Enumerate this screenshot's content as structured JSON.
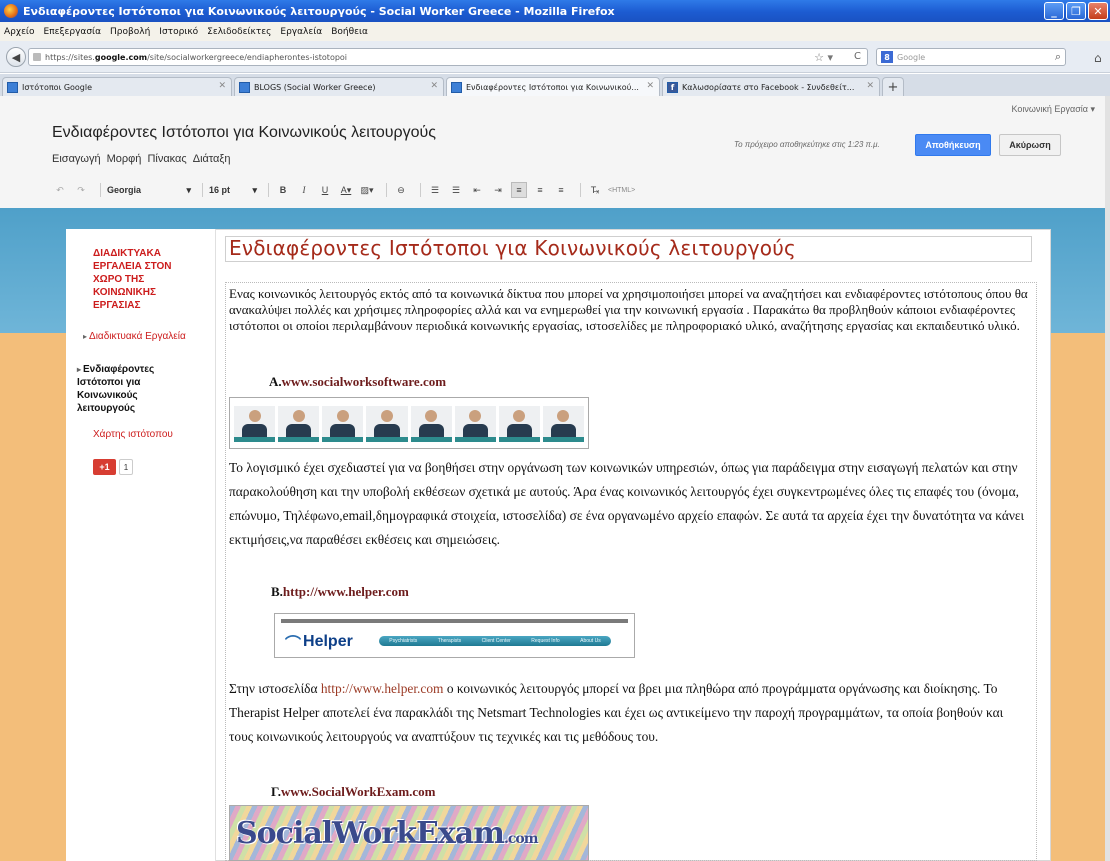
{
  "window": {
    "title": "Ενδιαφέροντες Ιστότοποι για Κοινωνικούς λειτουργούς - Social Worker Greece - Mozilla Firefox",
    "controls": [
      "_",
      "❐",
      "✕"
    ]
  },
  "menubar": [
    "Αρχείο",
    "Επεξεργασία",
    "Προβολή",
    "Ιστορικό",
    "Σελιδοδείκτες",
    "Εργαλεία",
    "Βοήθεια"
  ],
  "navbar": {
    "url_prefix": "https://sites.",
    "url_domain": "google.com",
    "url_suffix": "/site/socialworkergreece/endiapherontes-istotopoi",
    "search_placeholder": "Google"
  },
  "tabs": [
    {
      "label": "Ιστότοποι Google",
      "active": false,
      "icon": "google-sites-icon"
    },
    {
      "label": "BLOGS (Social Worker Greece)",
      "active": false,
      "icon": "google-sites-icon"
    },
    {
      "label": "Ενδιαφέροντες Ιστότοποι για Κοινωνικού...",
      "active": true,
      "icon": "google-sites-icon"
    },
    {
      "label": "Καλωσορίσατε στο Facebook - Συνδεθείτ...",
      "active": false,
      "icon": "facebook-icon"
    }
  ],
  "editor": {
    "account": "Κοινωνική Εργασία ▾",
    "site_title": "Ενδιαφέροντες Ιστότοποι για Κοινωνικούς λειτουργούς",
    "draft_status": "Το πρόχειρο αποθηκεύτηκε στις 1:23 π.μ.",
    "save_label": "Αποθήκευση",
    "cancel_label": "Ακύρωση",
    "menus": [
      "Εισαγωγή",
      "Μορφή",
      "Πίνακας",
      "Διάταξη"
    ],
    "font": "Georgia",
    "font_size": "16 pt",
    "html_label": "<HTML>"
  },
  "sidebar": {
    "heading": "ΔΙΑΔΙΚΤΥΑΚΑ ΕΡΓΑΛΕΙΑ ΣΤΟΝ ΧΩΡΟ ΤΗΣ ΚΟΙΝΩΝΙΚΗΣ ΕΡΓΑΣΙΑΣ",
    "item1": "Διαδικτυακά Εργαλεία",
    "item2": "Ενδιαφέροντες Ιστότοποι για Κοινωνικούς λειτουργούς",
    "sitemap": "Χάρτης ιστότοπου",
    "gplus": "+1",
    "gplus_count": "1"
  },
  "content": {
    "heading": "Ενδιαφέροντες Ιστότοποι για Κοινωνικούς λειτουργούς",
    "intro": "Ενας κοινωνικός λειτουργός εκτός από τα κοινωνικά δίκτυα που μπορεί να χρησιμοποιήσει  μπορεί να αναζητήσει και ενδιαφέροντες ιστότοπους όπου θα ανακαλύψει πολλές και χρήσιμες πληροφορίες αλλά και να ενημερωθεί για την κοινωνική εργασία . Παρακάτω θα προβληθούν κάποιοι ενδιαφέροντες ιστότοποι οι οποίοι περιλαμβάνουν περιοδικά κοινωνικής εργασίας, ιστοσελίδες με πληροφοριακό υλικό, αναζήτησης εργασίας και εκπαιδευτικό υλικό.",
    "site_a_letter": "A.",
    "site_a_url": "www.socialworksoftware.com",
    "para_a": "  Το λογισμικό έχει σχεδιαστεί για να βοηθήσει στην οργάνωση των κοινωνικών υπηρεσιών, όπως για παράδειγμα στην εισαγωγή πελατών και στην παρακολούθηση και την υποβολή εκθέσεων σχετικά με αυτούς. Άρα ένας κοινωνικός λειτουργός έχει  συγκεντρωμένες όλες τις επαφές του (όνομα, επώνυμο, Τηλέφωνο,email,δημογραφικά στοιχεία, ιστοσελίδα) σε ένα οργανωμένο αρχείο επαφών. Σε αυτά τα αρχεία έχει την δυνατότητα να κάνει εκτιμήσεις,να παραθέσει εκθέσεις και σημειώσεις.",
    "site_b_letter": "B.",
    "site_b_url": "http://www.helper.com",
    "helper_logo": "Helper",
    "helper_nav": [
      "Psychiatrists",
      "Therapists",
      "Client Center",
      "Request Info",
      "About Us"
    ],
    "para_b_start": "Στην ιστοσελίδα ",
    "para_b_link": "http://www.helper.com",
    "para_b_rest": " ο κοινωνικός λειτουργός μπορεί να βρει μια πληθώρα από προγράμματα οργάνωσης και διοίκησης. Το Therapist Helper αποτελεί ένα παρακλάδι της  Netsmart Technologies και έχει ως αντικείμενο την παροχή προγραμμάτων, τα οποία βοηθούν και τους κοινωνικούς λειτουργούς να αναπτύξουν τις τεχνικές και τις μεθόδους του.",
    "site_c_letter": "Γ.",
    "site_c_url": "www.SocialWorkExam.com",
    "swe_logo": "SocialWorkExam",
    "swe_logo_suffix": ".com"
  }
}
